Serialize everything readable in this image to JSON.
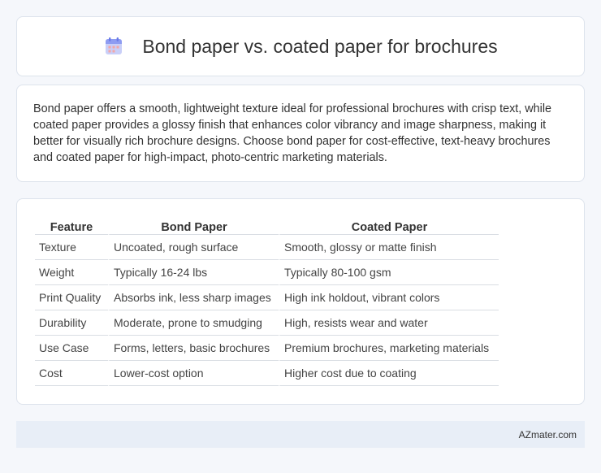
{
  "header": {
    "title": "Bond paper vs. coated paper for brochures",
    "icon": "calendar-icon"
  },
  "intro": {
    "text": "Bond paper offers a smooth, lightweight texture ideal for professional brochures with crisp text, while coated paper provides a glossy finish that enhances color vibrancy and image sharpness, making it better for visually rich brochure designs. Choose bond paper for cost-effective, text-heavy brochures and coated paper for high-impact, photo-centric marketing materials."
  },
  "table": {
    "headers": [
      "Feature",
      "Bond Paper",
      "Coated Paper"
    ],
    "rows": [
      [
        "Texture",
        "Uncoated, rough surface",
        "Smooth, glossy or matte finish"
      ],
      [
        "Weight",
        "Typically 16-24 lbs",
        "Typically 80-100 gsm"
      ],
      [
        "Print Quality",
        "Absorbs ink, less sharp images",
        "High ink holdout, vibrant colors"
      ],
      [
        "Durability",
        "Moderate, prone to smudging",
        "High, resists wear and water"
      ],
      [
        "Use Case",
        "Forms, letters, basic brochures",
        "Premium brochures, marketing materials"
      ],
      [
        "Cost",
        "Lower-cost option",
        "Higher cost due to coating"
      ]
    ]
  },
  "footer": {
    "source": "AZmater.com"
  },
  "colors": {
    "background": "#f5f7fb",
    "card": "#ffffff",
    "footer_bg": "#e8eef7",
    "icon_accent": "#7b8ff0"
  }
}
